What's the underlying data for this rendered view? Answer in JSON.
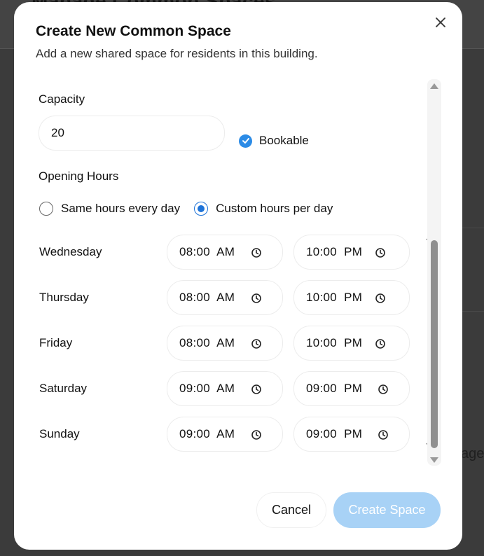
{
  "background": {
    "page_title": "Manage Common Spaces",
    "partial_text": "age"
  },
  "modal": {
    "title": "Create New Common Space",
    "subtitle": "Add a new shared space for residents in this building.",
    "close_icon": "close-icon",
    "capacity": {
      "label": "Capacity",
      "value": "20"
    },
    "bookable": {
      "label": "Bookable",
      "checked": true
    },
    "opening_hours": {
      "label": "Opening Hours",
      "options": [
        {
          "label": "Same hours every day",
          "selected": false
        },
        {
          "label": "Custom hours per day",
          "selected": true
        }
      ],
      "days": [
        {
          "name": "Wednesday",
          "open": "08:00  AM",
          "close": "10:00  PM"
        },
        {
          "name": "Thursday",
          "open": "08:00  AM",
          "close": "10:00  PM"
        },
        {
          "name": "Friday",
          "open": "08:00  AM",
          "close": "10:00  PM"
        },
        {
          "name": "Saturday",
          "open": "09:00  AM",
          "close": "09:00  PM"
        },
        {
          "name": "Sunday",
          "open": "09:00  AM",
          "close": "09:00  PM"
        }
      ]
    },
    "buttons": {
      "cancel": "Cancel",
      "create": "Create Space"
    }
  },
  "colors": {
    "accent": "#2b8be6",
    "create_button_disabled": "#a8d2f6",
    "overlay": "#3b3b3b"
  }
}
